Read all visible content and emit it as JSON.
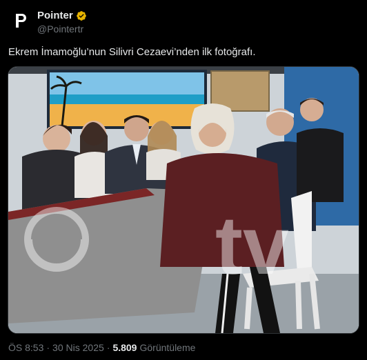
{
  "author": {
    "display_name": "Pointer",
    "handle": "@Pointertr",
    "avatar_icon": "pointer-logo-icon",
    "verified_icon": "verified-badge-icon",
    "verified_color": "#e8b400"
  },
  "tweet": {
    "text": "Ekrem İmamoğlu’nun Silivri Cezaevi’nden ilk fotoğrafı.",
    "media_watermark": "tv"
  },
  "meta": {
    "time": "ÖS 8:53",
    "separator": "·",
    "date": "30 Nis 2025",
    "views_count": "5.809",
    "views_label": "Görüntüleme"
  },
  "colors": {
    "background": "#000000",
    "text": "#e7e9ea",
    "secondary_text": "#71767b"
  }
}
